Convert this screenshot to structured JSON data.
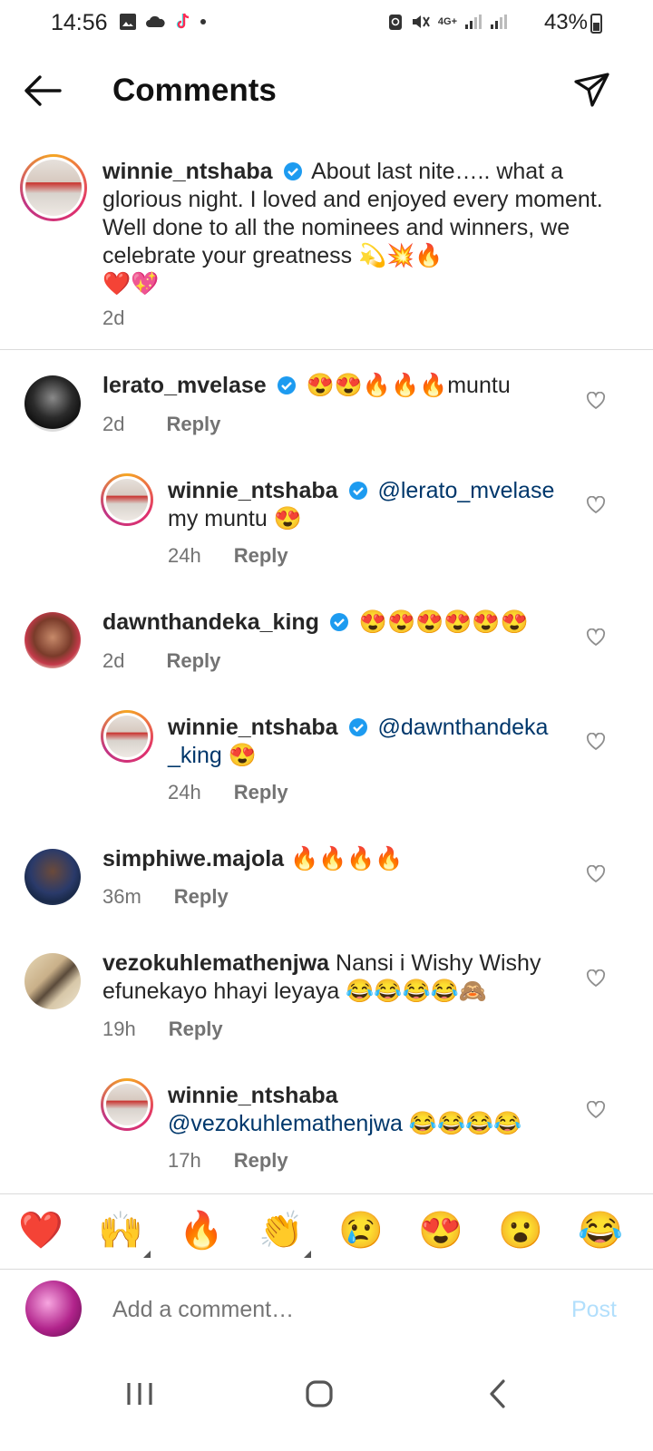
{
  "status": {
    "time": "14:56",
    "network": "4G+",
    "battery": "43%"
  },
  "header": {
    "title": "Comments"
  },
  "caption": {
    "username": "winnie_ntshaba",
    "text": "About last nite….. what a glorious night. I loved and enjoyed every moment. Well done to all the nominees and winners, we celebrate your greatness",
    "emojis_line1": "💫💥🔥",
    "emojis_line2": "❤️💖",
    "time": "2d"
  },
  "comments": [
    {
      "username": "lerato_mvelase",
      "verified": true,
      "emojis": "😍😍🔥🔥🔥",
      "text": "muntu",
      "time": "2d",
      "reply": "Reply"
    },
    {
      "username": "winnie_ntshaba",
      "verified": true,
      "mention": "@lerato_mvelase",
      "text": "my muntu",
      "emojis": "😍",
      "time": "24h",
      "reply": "Reply"
    },
    {
      "username": "dawnthandeka_king",
      "verified": true,
      "emojis": "😍😍😍😍😍😍",
      "time": "2d",
      "reply": "Reply"
    },
    {
      "username": "winnie_ntshaba",
      "verified": true,
      "mention_a": "@dawnthandeka",
      "mention_b": "_king",
      "emojis": "😍",
      "time": "24h",
      "reply": "Reply"
    },
    {
      "username": "simphiwe.majola",
      "verified": false,
      "emojis": "🔥🔥🔥🔥",
      "time": "36m",
      "reply": "Reply"
    },
    {
      "username": "vezokuhlemathenjwa",
      "verified": false,
      "text_a": "Nansi i Wishy Wishy",
      "text_b": "efunekayo hhayi leyaya",
      "emojis": "😂😂😂😂🙈",
      "time": "19h",
      "reply": "Reply"
    },
    {
      "username": "winnie_ntshaba",
      "verified": false,
      "mention": "@vezokuhlemathenjwa",
      "emojis": "😂😂😂😂",
      "time": "17h",
      "reply": "Reply"
    }
  ],
  "reactions": [
    "❤️",
    "🙌",
    "🔥",
    "👏",
    "😢",
    "😍",
    "😮",
    "😂"
  ],
  "composer": {
    "placeholder": "Add a comment…",
    "post_label": "Post"
  }
}
